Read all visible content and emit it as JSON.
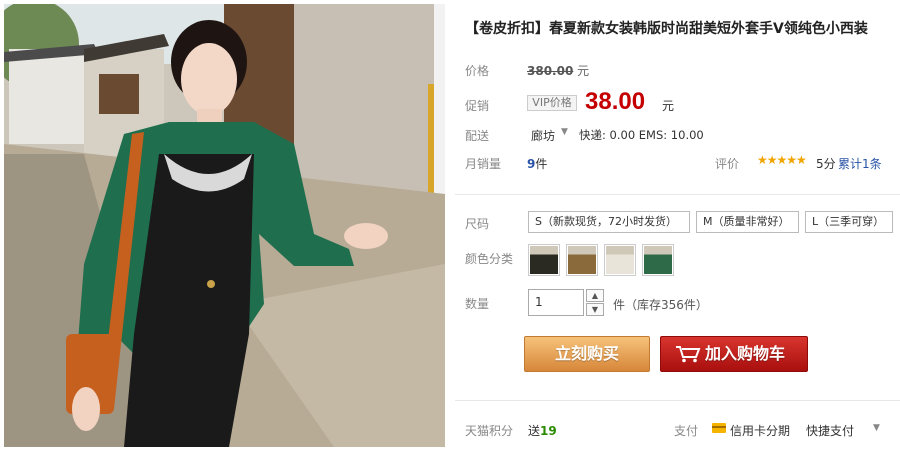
{
  "product": {
    "title": "【卷皮折扣】春夏新款女装韩版时尚甜美短外套手V领纯色小西装"
  },
  "price": {
    "label": "价格",
    "original": "380.00",
    "unit": "元"
  },
  "promo": {
    "label": "促销",
    "vip_tag": "VIP价格",
    "price": "38.00",
    "unit": "元"
  },
  "shipping": {
    "label": "配送",
    "city": "廊坊",
    "info": "快递: 0.00 EMS: 10.00"
  },
  "sales": {
    "label": "月销量",
    "count": "9",
    "unit": "件",
    "rating_label": "评价",
    "stars": "★★★★★",
    "score": "5分",
    "review_link": "累计1条"
  },
  "size": {
    "label": "尺码",
    "options": [
      "S（新款现货，72小时发货）",
      "M（质量非常好）",
      "L（三季可穿）"
    ]
  },
  "color": {
    "label": "颜色分类",
    "swatches": [
      "#3a3a2a",
      "#8a6a3a",
      "#cfc8b8",
      "#3c6a48"
    ]
  },
  "quantity": {
    "label": "数量",
    "value": "1",
    "stock_text": "件（库存356件）"
  },
  "buttons": {
    "buy_now": "立刻购买",
    "add_cart": "加入购物车"
  },
  "footer": {
    "points_label": "天猫积分",
    "points_prefix": "送",
    "points_value": "19",
    "pay_label": "支付",
    "pay_card": "信用卡分期",
    "pay_quick": "快捷支付"
  },
  "colors": {
    "price_red": "#c40000",
    "link_blue": "#2953a6",
    "buy_orange": "#e49a4f",
    "cart_red": "#c0201c"
  }
}
